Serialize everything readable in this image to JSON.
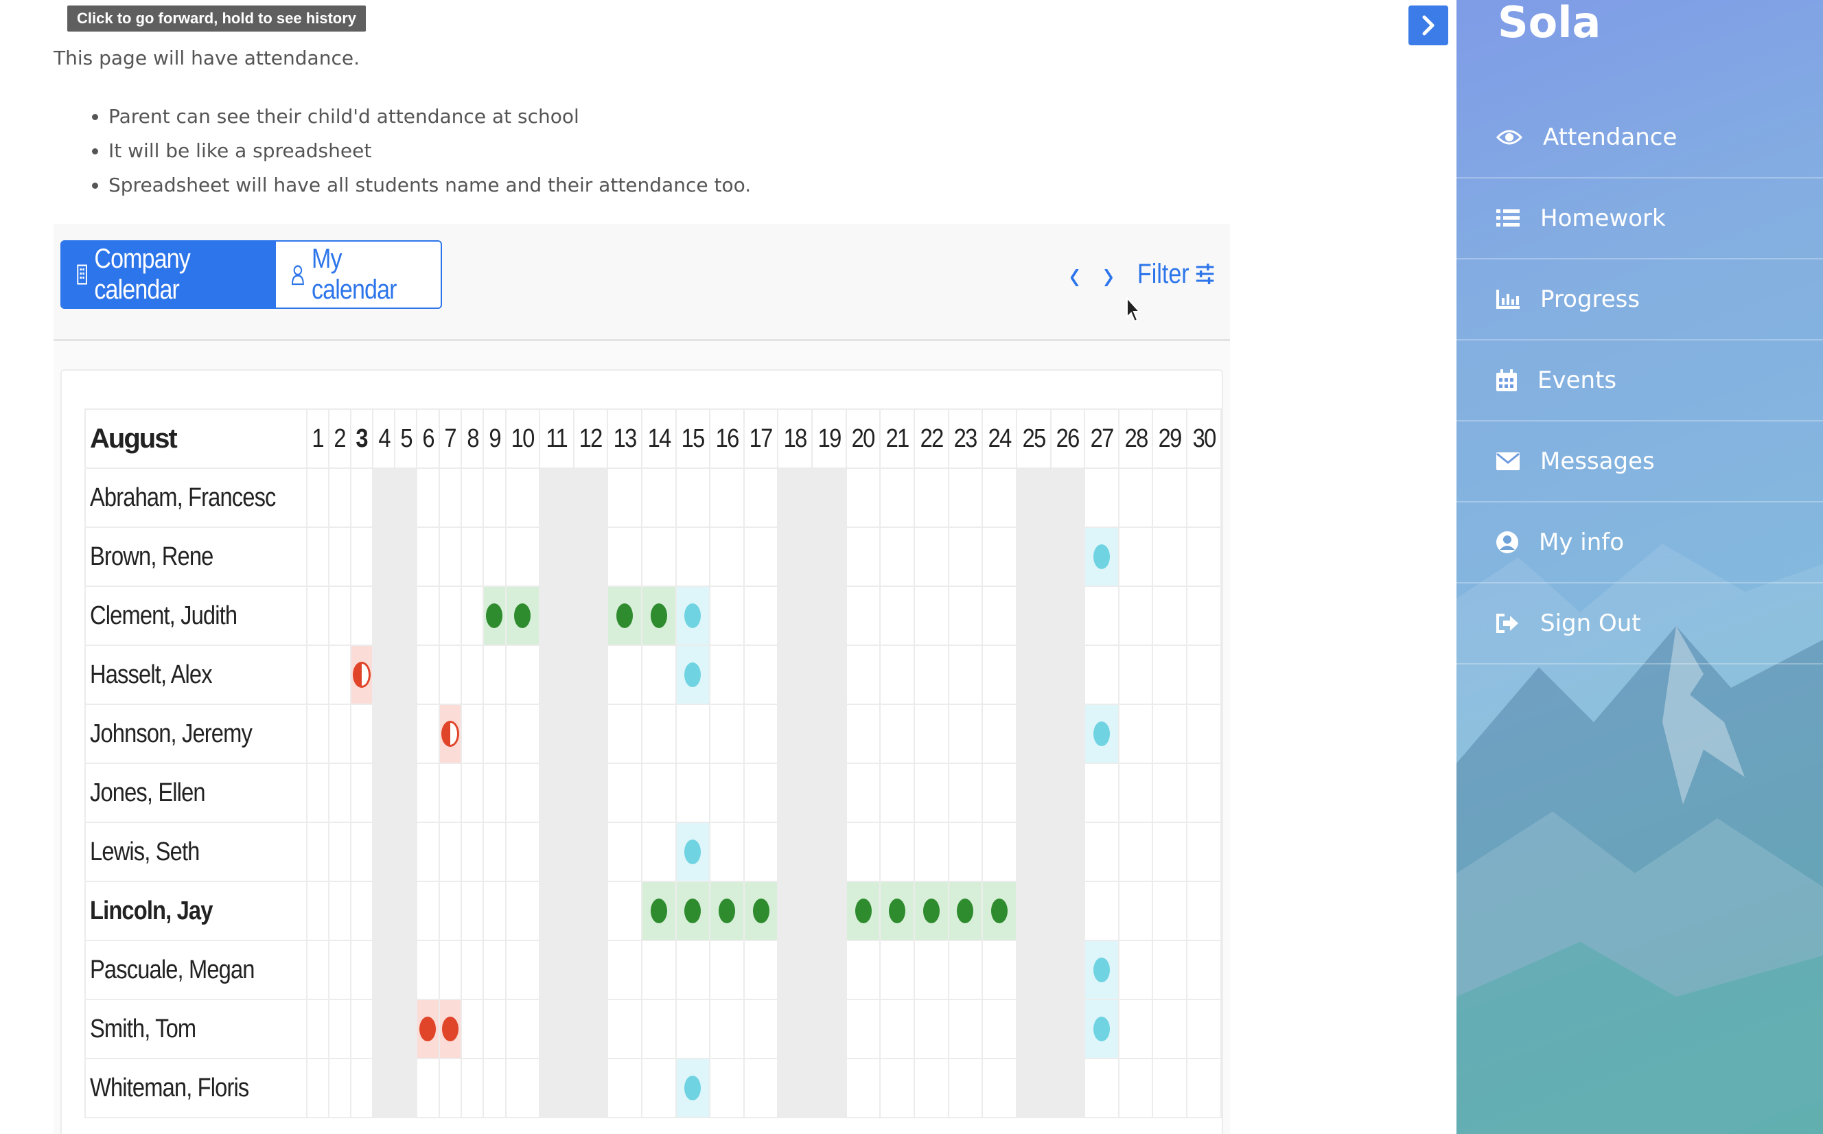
{
  "tooltip": "Click to go forward, hold to see history",
  "intro": "This page will have attendance.",
  "bullets": [
    "Parent can see their child'd attendance at school",
    "It will be like a spreadsheet",
    "Spreadsheet will have all students name and their attendance too."
  ],
  "calendar": {
    "tabs": [
      "Company calendar",
      "My calendar"
    ],
    "active_tab": "Company calendar",
    "filter_label": "Filter",
    "month": "August",
    "days": [
      1,
      2,
      3,
      4,
      5,
      6,
      7,
      8,
      9,
      10,
      11,
      12,
      13,
      14,
      15,
      16,
      17,
      18,
      19,
      20,
      21,
      22,
      23,
      24,
      25,
      26,
      27,
      28,
      29,
      30
    ],
    "bold_day": 3,
    "weekend_days": [
      4,
      5,
      11,
      12,
      18,
      19,
      25,
      26
    ],
    "colors": {
      "accent": "#2d75ea",
      "present": "#2e8b2e",
      "late": "#6fd3e2",
      "absent": "#e0452a"
    },
    "rows": [
      {
        "name": "Abraham, Francesc",
        "marks": {}
      },
      {
        "name": "Brown, Rene",
        "marks": {
          "27": "late"
        }
      },
      {
        "name": "Clement, Judith",
        "marks": {
          "9": "present",
          "10": "present",
          "13": "present",
          "14": "present",
          "15": "late"
        }
      },
      {
        "name": "Hasselt, Alex",
        "marks": {
          "3": "half-absent",
          "15": "late"
        }
      },
      {
        "name": "Johnson, Jeremy",
        "marks": {
          "7": "half-absent",
          "27": "late"
        }
      },
      {
        "name": "Jones, Ellen",
        "marks": {}
      },
      {
        "name": "Lewis, Seth",
        "marks": {
          "15": "late"
        }
      },
      {
        "name": "Lincoln, Jay",
        "bold": true,
        "marks": {
          "14": "present",
          "15": "present",
          "16": "present",
          "17": "present",
          "20": "present",
          "21": "present",
          "22": "present",
          "23": "present",
          "24": "present"
        }
      },
      {
        "name": "Pascuale, Megan",
        "marks": {
          "27": "late"
        }
      },
      {
        "name": "Smith, Tom",
        "marks": {
          "6": "absent",
          "7": "absent",
          "27": "late"
        }
      },
      {
        "name": "Whiteman, Floris",
        "marks": {
          "15": "late"
        }
      }
    ]
  },
  "sidebar": {
    "brand": "Sola",
    "items": [
      {
        "label": "Attendance",
        "icon": "eye-icon"
      },
      {
        "label": "Homework",
        "icon": "list-icon"
      },
      {
        "label": "Progress",
        "icon": "bar-chart-icon"
      },
      {
        "label": "Events",
        "icon": "calendar-icon"
      },
      {
        "label": "Messages",
        "icon": "envelope-icon"
      },
      {
        "label": "My info",
        "icon": "user-circle-icon"
      },
      {
        "label": "Sign Out",
        "icon": "sign-out-icon"
      }
    ]
  }
}
